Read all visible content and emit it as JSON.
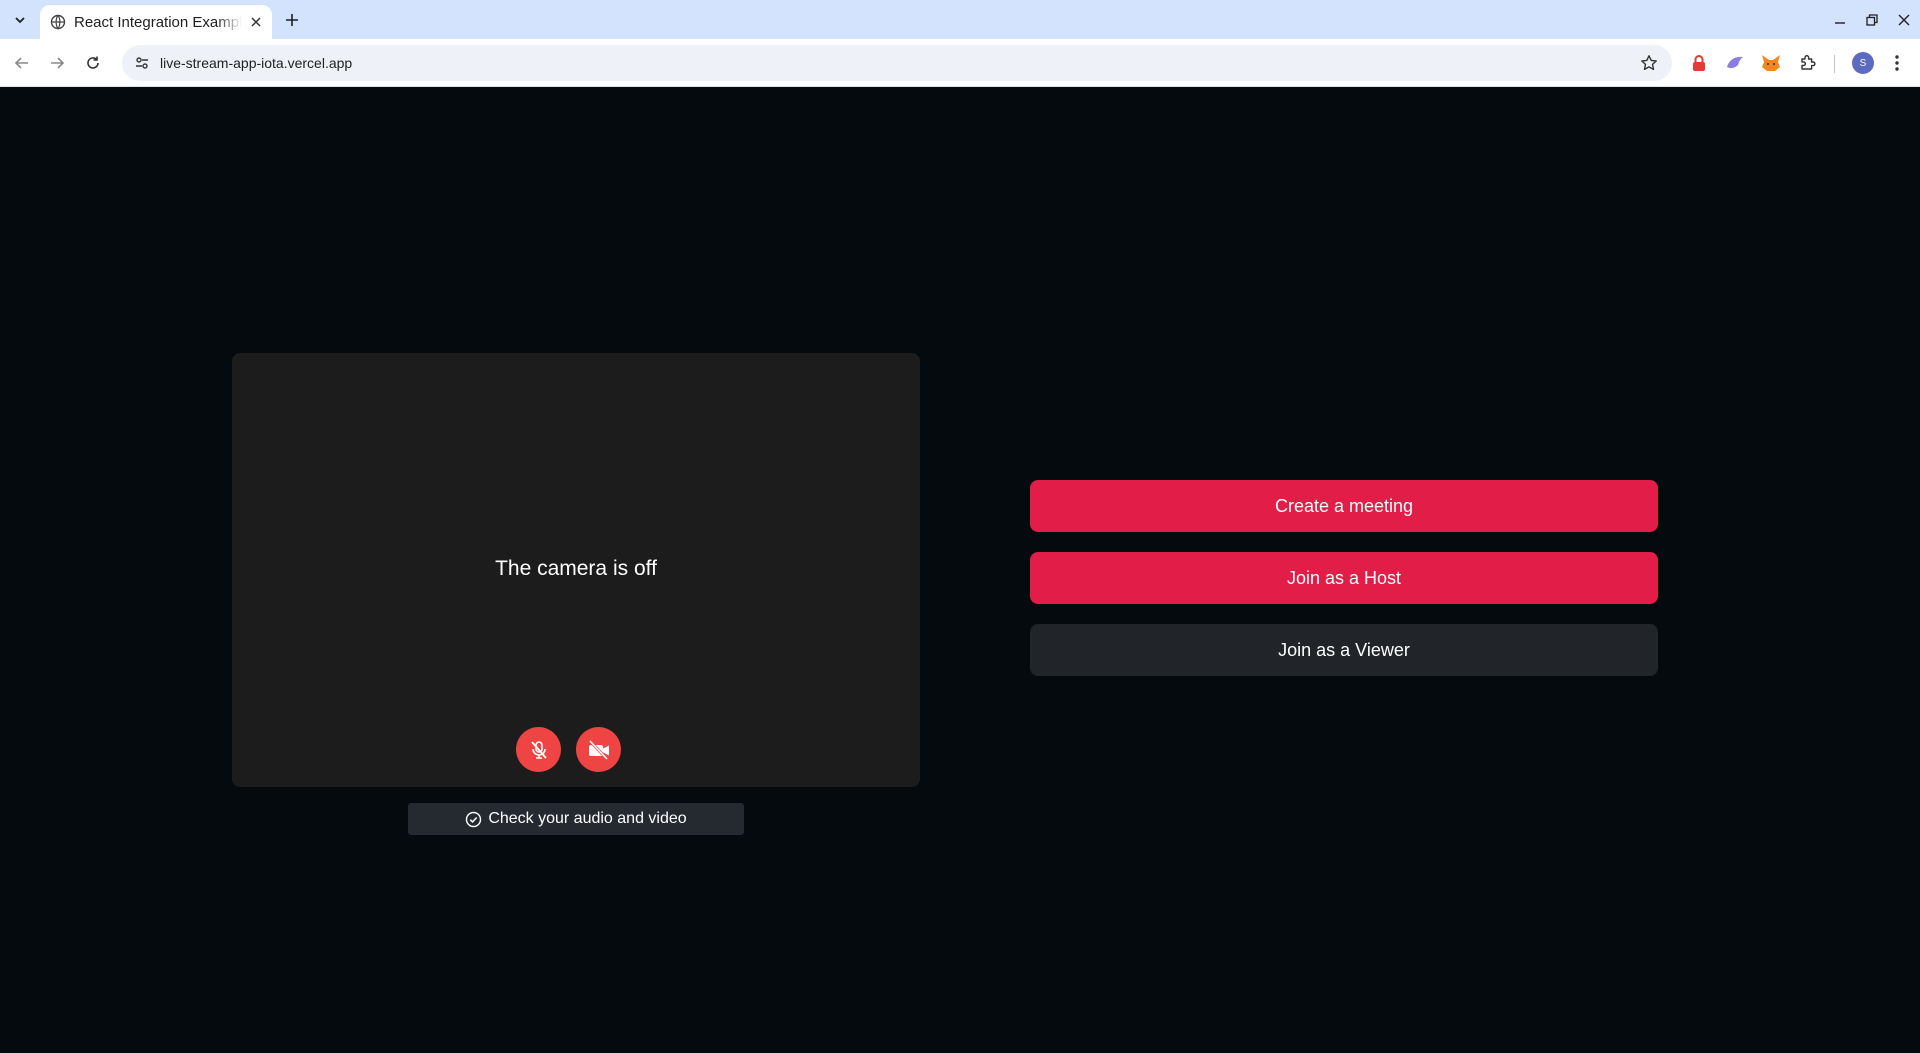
{
  "browser": {
    "tab": {
      "title": "React Integration Example"
    },
    "address_bar": {
      "url": "live-stream-app-iota.vercel.app"
    },
    "profile_initial": "S"
  },
  "preview": {
    "camera_status_text": "The camera is off",
    "mic_button_state": "muted",
    "camera_button_state": "off",
    "check_av_label": "Check your audio and video"
  },
  "actions": {
    "create_meeting_label": "Create a meeting",
    "join_host_label": "Join as a Host",
    "join_viewer_label": "Join as a Viewer"
  },
  "colors": {
    "page_background": "#050a0e",
    "preview_background": "#1c1c1c",
    "primary_button": "#e11d48",
    "secondary_button": "#212529",
    "media_button": "#ef4444"
  }
}
